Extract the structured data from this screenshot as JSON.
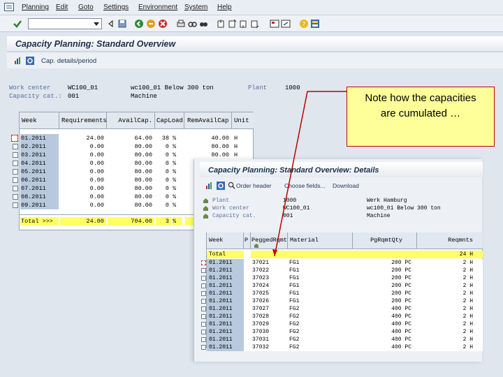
{
  "menu": [
    "Planning",
    "Edit",
    "Goto",
    "Settings",
    "Environment",
    "System",
    "Help"
  ],
  "screen_title": "Capacity Planning: Standard Overview",
  "app_toolbar": {
    "label": "Cap. details/period"
  },
  "header_fields": {
    "work_center_label": "Work center",
    "work_center_value": "WC100_01",
    "work_center_desc": "wc100_01 Below 300 ton",
    "plant_label": "Plant",
    "plant_value": "1000",
    "capacity_cat_label": "Capacity cat.:",
    "capacity_cat_value": "001",
    "capacity_cat_desc": "Machine"
  },
  "overview_table": {
    "columns": [
      "Week",
      "Requirements",
      "AvailCap.",
      "CapLoad",
      "RemAvailCap",
      "Unit"
    ],
    "rows": [
      {
        "week": "01.2011",
        "req": "24.00",
        "avail": "64.00",
        "load": "38",
        "pct": "%",
        "rem": "40.00",
        "unit": "H"
      },
      {
        "week": "02.2011",
        "req": "0.00",
        "avail": "80.00",
        "load": "0",
        "pct": "%",
        "rem": "80.00",
        "unit": "H"
      },
      {
        "week": "03.2011",
        "req": "0.00",
        "avail": "80.00",
        "load": "0",
        "pct": "%",
        "rem": "80.00",
        "unit": "H"
      },
      {
        "week": "04.2011",
        "req": "0.00",
        "avail": "80.00",
        "load": "0",
        "pct": "%",
        "rem": "",
        "unit": ""
      },
      {
        "week": "05.2011",
        "req": "0.00",
        "avail": "80.00",
        "load": "0",
        "pct": "%",
        "rem": "",
        "unit": ""
      },
      {
        "week": "06.2011",
        "req": "0.00",
        "avail": "80.00",
        "load": "0",
        "pct": "%",
        "rem": "",
        "unit": ""
      },
      {
        "week": "07.2011",
        "req": "0.00",
        "avail": "80.00",
        "load": "0",
        "pct": "%",
        "rem": "",
        "unit": ""
      },
      {
        "week": "08.2011",
        "req": "0.00",
        "avail": "80.00",
        "load": "0",
        "pct": "%",
        "rem": "",
        "unit": ""
      },
      {
        "week": "09.2011",
        "req": "0.00",
        "avail": "80.00",
        "load": "0",
        "pct": "%",
        "rem": "",
        "unit": ""
      }
    ],
    "total": {
      "label": "Total  >>>",
      "req": "24.00",
      "avail": "704.00",
      "load": "3",
      "pct": "%"
    }
  },
  "details": {
    "title": "Capacity Planning: Standard Overview: Details",
    "toolbar": [
      "Order header",
      "Choose fields...",
      "Download"
    ],
    "plant_label": "Plant",
    "plant_value": "1000",
    "plant_desc": "Werk Hamburg",
    "work_center_label": "Work center",
    "work_center_value": "WC100_01",
    "work_center_desc": "wc100_01 Below 300 ton",
    "capacity_cat_label": "Capacity cat.",
    "capacity_cat_value": "001",
    "capacity_cat_desc": "Machine",
    "columns": [
      "Week",
      "P",
      "PeggedRqmt",
      "Material",
      "PgRqmtQty",
      "Reqmnts"
    ],
    "total_label": "Total",
    "total_req": "24 H",
    "rows": [
      {
        "week": "01.2011",
        "peg": "37021",
        "mat": "FG1",
        "qty": "200 PC",
        "req": "2 H"
      },
      {
        "week": "01.2011",
        "peg": "37022",
        "mat": "FG1",
        "qty": "200 PC",
        "req": "2 H"
      },
      {
        "week": "01.2011",
        "peg": "37023",
        "mat": "FG1",
        "qty": "200 PC",
        "req": "2 H"
      },
      {
        "week": "01.2011",
        "peg": "37024",
        "mat": "FG1",
        "qty": "200 PC",
        "req": "2 H"
      },
      {
        "week": "01.2011",
        "peg": "37025",
        "mat": "FG1",
        "qty": "200 PC",
        "req": "2 H"
      },
      {
        "week": "01.2011",
        "peg": "37026",
        "mat": "FG1",
        "qty": "200 PC",
        "req": "2 H"
      },
      {
        "week": "01.2011",
        "peg": "37027",
        "mat": "FG2",
        "qty": "400 PC",
        "req": "2 H"
      },
      {
        "week": "01.2011",
        "peg": "37028",
        "mat": "FG2",
        "qty": "400 PC",
        "req": "2 H"
      },
      {
        "week": "01.2011",
        "peg": "37029",
        "mat": "FG2",
        "qty": "400 PC",
        "req": "2 H"
      },
      {
        "week": "01.2011",
        "peg": "37030",
        "mat": "FG2",
        "qty": "400 PC",
        "req": "2 H"
      },
      {
        "week": "01.2011",
        "peg": "37031",
        "mat": "FG2",
        "qty": "400 PC",
        "req": "2 H"
      },
      {
        "week": "01.2011",
        "peg": "37032",
        "mat": "FG2",
        "qty": "400 PC",
        "req": "2 H"
      }
    ]
  },
  "callout": {
    "line1": "Note how the capacities",
    "line2": "are cumulated …"
  },
  "colors": {
    "callout_bg": "#ffff99",
    "callout_border": "#c00000",
    "total_row": "#ffff66",
    "week_cell": "#b8c9de",
    "header_bg": "#e2e8ef"
  }
}
